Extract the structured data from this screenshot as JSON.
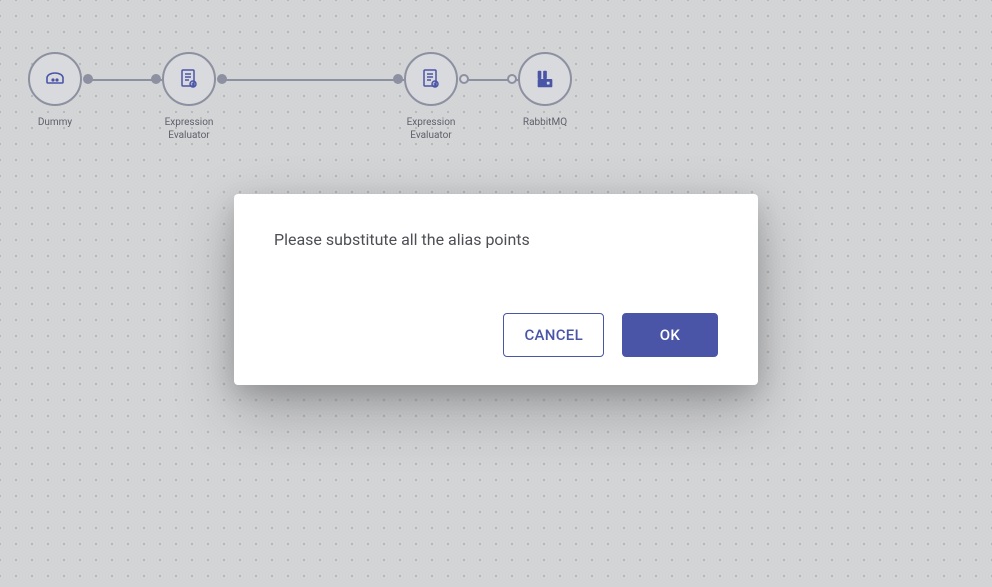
{
  "nodes": [
    {
      "label": "Dummy",
      "icon": "dummy-icon"
    },
    {
      "label": "Expression\nEvaluator",
      "icon": "expression-evaluator-icon"
    },
    {
      "label": "Expression\nEvaluator",
      "icon": "expression-evaluator-icon"
    },
    {
      "label": "RabbitMQ",
      "icon": "rabbitmq-icon"
    }
  ],
  "dialog": {
    "message": "Please substitute all the alias points",
    "cancel_label": "CANCEL",
    "ok_label": "OK"
  },
  "colors": {
    "accent": "#4a55a8",
    "node_border": "#8d90a0"
  }
}
